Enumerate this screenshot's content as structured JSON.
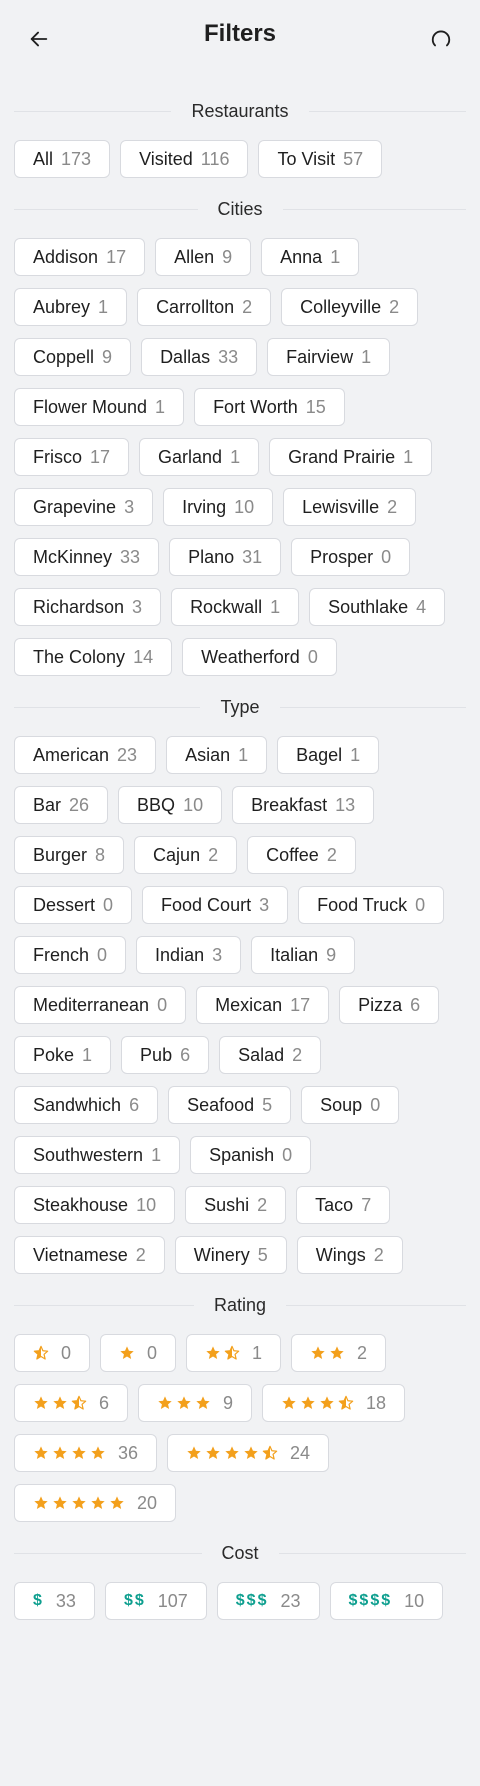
{
  "header": {
    "title": "Filters",
    "back_icon": "arrow-left-icon",
    "reset_icon": "reset-icon"
  },
  "restaurants": {
    "label": "Restaurants",
    "items": [
      {
        "name": "All",
        "count": "173"
      },
      {
        "name": "Visited",
        "count": "116"
      },
      {
        "name": "To Visit",
        "count": "57"
      }
    ]
  },
  "cities": {
    "label": "Cities",
    "items": [
      {
        "name": "Addison",
        "count": "17"
      },
      {
        "name": "Allen",
        "count": "9"
      },
      {
        "name": "Anna",
        "count": "1"
      },
      {
        "name": "Aubrey",
        "count": "1"
      },
      {
        "name": "Carrollton",
        "count": "2"
      },
      {
        "name": "Colleyville",
        "count": "2"
      },
      {
        "name": "Coppell",
        "count": "9"
      },
      {
        "name": "Dallas",
        "count": "33"
      },
      {
        "name": "Fairview",
        "count": "1"
      },
      {
        "name": "Flower Mound",
        "count": "1"
      },
      {
        "name": "Fort Worth",
        "count": "15"
      },
      {
        "name": "Frisco",
        "count": "17"
      },
      {
        "name": "Garland",
        "count": "1"
      },
      {
        "name": "Grand Prairie",
        "count": "1"
      },
      {
        "name": "Grapevine",
        "count": "3"
      },
      {
        "name": "Irving",
        "count": "10"
      },
      {
        "name": "Lewisville",
        "count": "2"
      },
      {
        "name": "McKinney",
        "count": "33"
      },
      {
        "name": "Plano",
        "count": "31"
      },
      {
        "name": "Prosper",
        "count": "0"
      },
      {
        "name": "Richardson",
        "count": "3"
      },
      {
        "name": "Rockwall",
        "count": "1"
      },
      {
        "name": "Southlake",
        "count": "4"
      },
      {
        "name": "The Colony",
        "count": "14"
      },
      {
        "name": "Weatherford",
        "count": "0"
      }
    ]
  },
  "type": {
    "label": "Type",
    "items": [
      {
        "name": "American",
        "count": "23"
      },
      {
        "name": "Asian",
        "count": "1"
      },
      {
        "name": "Bagel",
        "count": "1"
      },
      {
        "name": "Bar",
        "count": "26"
      },
      {
        "name": "BBQ",
        "count": "10"
      },
      {
        "name": "Breakfast",
        "count": "13"
      },
      {
        "name": "Burger",
        "count": "8"
      },
      {
        "name": "Cajun",
        "count": "2"
      },
      {
        "name": "Coffee",
        "count": "2"
      },
      {
        "name": "Dessert",
        "count": "0"
      },
      {
        "name": "Food Court",
        "count": "3"
      },
      {
        "name": "Food Truck",
        "count": "0"
      },
      {
        "name": "French",
        "count": "0"
      },
      {
        "name": "Indian",
        "count": "3"
      },
      {
        "name": "Italian",
        "count": "9"
      },
      {
        "name": "Mediterranean",
        "count": "0"
      },
      {
        "name": "Mexican",
        "count": "17"
      },
      {
        "name": "Pizza",
        "count": "6"
      },
      {
        "name": "Poke",
        "count": "1"
      },
      {
        "name": "Pub",
        "count": "6"
      },
      {
        "name": "Salad",
        "count": "2"
      },
      {
        "name": "Sandwhich",
        "count": "6"
      },
      {
        "name": "Seafood",
        "count": "5"
      },
      {
        "name": "Soup",
        "count": "0"
      },
      {
        "name": "Southwestern",
        "count": "1"
      },
      {
        "name": "Spanish",
        "count": "0"
      },
      {
        "name": "Steakhouse",
        "count": "10"
      },
      {
        "name": "Sushi",
        "count": "2"
      },
      {
        "name": "Taco",
        "count": "7"
      },
      {
        "name": "Vietnamese",
        "count": "2"
      },
      {
        "name": "Winery",
        "count": "5"
      },
      {
        "name": "Wings",
        "count": "2"
      }
    ]
  },
  "rating": {
    "label": "Rating",
    "star_color": "#f3a01c",
    "items": [
      {
        "stars": 0.5,
        "count": "0"
      },
      {
        "stars": 1,
        "count": "0"
      },
      {
        "stars": 1.5,
        "count": "1"
      },
      {
        "stars": 2,
        "count": "2"
      },
      {
        "stars": 2.5,
        "count": "6"
      },
      {
        "stars": 3,
        "count": "9"
      },
      {
        "stars": 3.5,
        "count": "18"
      },
      {
        "stars": 4,
        "count": "36"
      },
      {
        "stars": 4.5,
        "count": "24"
      },
      {
        "stars": 5,
        "count": "20"
      }
    ]
  },
  "cost": {
    "label": "Cost",
    "color": "#0e9f8f",
    "items": [
      {
        "symbol": "$",
        "count": "33"
      },
      {
        "symbol": "$$",
        "count": "107"
      },
      {
        "symbol": "$$$",
        "count": "23"
      },
      {
        "symbol": "$$$$",
        "count": "10"
      }
    ]
  }
}
